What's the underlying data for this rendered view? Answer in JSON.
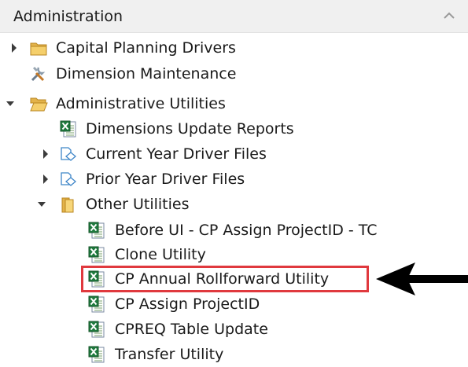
{
  "panel": {
    "title": "Administration",
    "collapse_icon": "chevron-up-icon"
  },
  "tree": {
    "capital_planning_drivers": {
      "label": "Capital Planning Drivers",
      "icon": "folder-icon",
      "expanded": false
    },
    "dimension_maintenance": {
      "label": "Dimension Maintenance",
      "icon": "tools-icon"
    },
    "administrative_utilities": {
      "label": "Administrative Utilities",
      "icon": "folder-open-icon",
      "expanded": true
    },
    "dimensions_update_reports": {
      "label": "Dimensions Update Reports",
      "icon": "excel-report-icon"
    },
    "current_year_driver_files": {
      "label": "Current Year Driver Files",
      "icon": "file-group-icon",
      "expanded": false
    },
    "prior_year_driver_files": {
      "label": "Prior Year Driver Files",
      "icon": "file-group-icon",
      "expanded": false
    },
    "other_utilities": {
      "label": "Other Utilities",
      "icon": "folder-icon",
      "expanded": true
    },
    "before_ui_cp_assign": {
      "label": "Before UI - CP Assign ProjectID - TC",
      "icon": "excel-report-icon"
    },
    "clone_utility": {
      "label": "Clone Utility",
      "icon": "excel-report-icon"
    },
    "cp_annual_rollforward": {
      "label": "CP Annual Rollforward Utility",
      "icon": "excel-report-icon",
      "highlighted": true
    },
    "cp_assign_projectid": {
      "label": "CP Assign ProjectID",
      "icon": "excel-report-icon"
    },
    "cpreq_table_update": {
      "label": "CPREQ Table Update",
      "icon": "excel-report-icon"
    },
    "transfer_utility": {
      "label": "Transfer Utility",
      "icon": "excel-report-icon"
    }
  },
  "annotation": {
    "highlight_color": "#e0393e",
    "arrow_color": "#000000",
    "arrow_icon": "arrow-left-icon"
  }
}
